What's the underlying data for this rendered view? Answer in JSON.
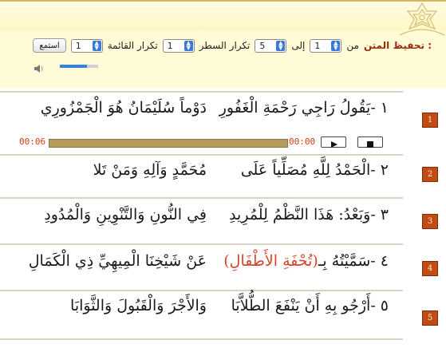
{
  "controls": {
    "title": "تحفيظ المتن :",
    "from_label": "من",
    "from_value": "1",
    "to_label": "إلى",
    "to_value": "5",
    "line_repeat_label": "تكرار السطر",
    "line_repeat_value": "1",
    "list_repeat_label": "تكرار القائمة",
    "list_repeat_value": "1",
    "listen_button": "استمع",
    "volume_level": 0.7
  },
  "player": {
    "current_time": "00:00",
    "total_time": "00:06",
    "progress": 0
  },
  "verses": [
    {
      "num": "1",
      "right": "١ -يَقُولُ رَاجِي رَحْمَةِ الْغَفُورِ",
      "left": "دَوْماً سُلَيْمَانُ هُوَ الْجَمْزُورِي"
    },
    {
      "num": "2",
      "right": "٢ -الْحَمْدُ لِلَّهِ مُصَلِّياً عَلَى",
      "left": "مُحَمَّدٍ وَآلِهِ وَمَنْ تَلا"
    },
    {
      "num": "3",
      "right": "٣ -وَبَعْدُ: هَذَا النَّظْمُ لِلْمُرِيدِ",
      "left": "فِي النُّونِ وَالتَّنْوِينِ وَالْمُدُودِ"
    },
    {
      "num": "4",
      "right_pre": "٤ -سَمَّيْتُهُ بِـ",
      "right_title": "(تُحْفَةِ الأَطْفَالِ)",
      "left": "عَنْ شَيْخِنَا الْمِيهِيِّ ذِي الْكَمَالِ"
    },
    {
      "num": "5",
      "right": "٥ -أَرْجُو بِهِ أَنْ يَنْفَعَ الطُّلاَّبَا",
      "left": "وَالأَجْرَ وَالْقَبُولَ وَالثَّوَابَا"
    }
  ],
  "colors": {
    "header_bg": "#fffbd6",
    "badge": "#c24a14",
    "time_text": "#d83a15",
    "accent_title": "#d2472a"
  }
}
